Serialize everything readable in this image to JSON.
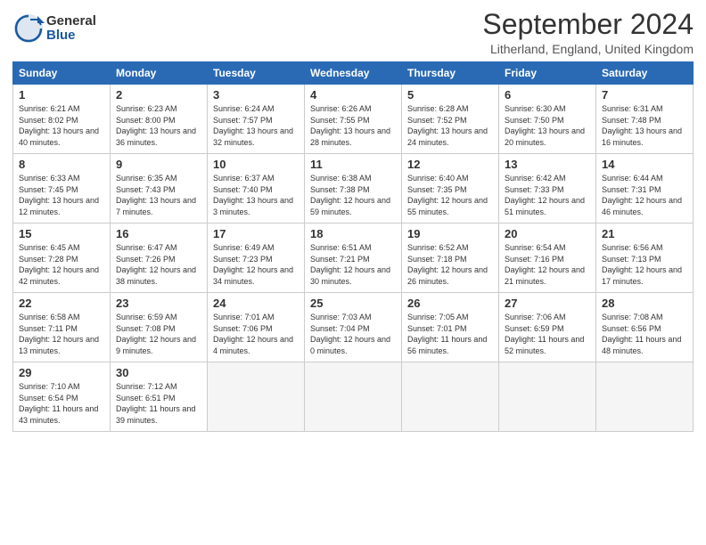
{
  "logo": {
    "general": "General",
    "blue": "Blue"
  },
  "title": "September 2024",
  "location": "Litherland, England, United Kingdom",
  "days_of_week": [
    "Sunday",
    "Monday",
    "Tuesday",
    "Wednesday",
    "Thursday",
    "Friday",
    "Saturday"
  ],
  "weeks": [
    [
      {
        "day": "1",
        "sunrise": "6:21 AM",
        "sunset": "8:02 PM",
        "daylight": "13 hours and 40 minutes."
      },
      {
        "day": "2",
        "sunrise": "6:23 AM",
        "sunset": "8:00 PM",
        "daylight": "13 hours and 36 minutes."
      },
      {
        "day": "3",
        "sunrise": "6:24 AM",
        "sunset": "7:57 PM",
        "daylight": "13 hours and 32 minutes."
      },
      {
        "day": "4",
        "sunrise": "6:26 AM",
        "sunset": "7:55 PM",
        "daylight": "13 hours and 28 minutes."
      },
      {
        "day": "5",
        "sunrise": "6:28 AM",
        "sunset": "7:52 PM",
        "daylight": "13 hours and 24 minutes."
      },
      {
        "day": "6",
        "sunrise": "6:30 AM",
        "sunset": "7:50 PM",
        "daylight": "13 hours and 20 minutes."
      },
      {
        "day": "7",
        "sunrise": "6:31 AM",
        "sunset": "7:48 PM",
        "daylight": "13 hours and 16 minutes."
      }
    ],
    [
      {
        "day": "8",
        "sunrise": "6:33 AM",
        "sunset": "7:45 PM",
        "daylight": "13 hours and 12 minutes."
      },
      {
        "day": "9",
        "sunrise": "6:35 AM",
        "sunset": "7:43 PM",
        "daylight": "13 hours and 7 minutes."
      },
      {
        "day": "10",
        "sunrise": "6:37 AM",
        "sunset": "7:40 PM",
        "daylight": "13 hours and 3 minutes."
      },
      {
        "day": "11",
        "sunrise": "6:38 AM",
        "sunset": "7:38 PM",
        "daylight": "12 hours and 59 minutes."
      },
      {
        "day": "12",
        "sunrise": "6:40 AM",
        "sunset": "7:35 PM",
        "daylight": "12 hours and 55 minutes."
      },
      {
        "day": "13",
        "sunrise": "6:42 AM",
        "sunset": "7:33 PM",
        "daylight": "12 hours and 51 minutes."
      },
      {
        "day": "14",
        "sunrise": "6:44 AM",
        "sunset": "7:31 PM",
        "daylight": "12 hours and 46 minutes."
      }
    ],
    [
      {
        "day": "15",
        "sunrise": "6:45 AM",
        "sunset": "7:28 PM",
        "daylight": "12 hours and 42 minutes."
      },
      {
        "day": "16",
        "sunrise": "6:47 AM",
        "sunset": "7:26 PM",
        "daylight": "12 hours and 38 minutes."
      },
      {
        "day": "17",
        "sunrise": "6:49 AM",
        "sunset": "7:23 PM",
        "daylight": "12 hours and 34 minutes."
      },
      {
        "day": "18",
        "sunrise": "6:51 AM",
        "sunset": "7:21 PM",
        "daylight": "12 hours and 30 minutes."
      },
      {
        "day": "19",
        "sunrise": "6:52 AM",
        "sunset": "7:18 PM",
        "daylight": "12 hours and 26 minutes."
      },
      {
        "day": "20",
        "sunrise": "6:54 AM",
        "sunset": "7:16 PM",
        "daylight": "12 hours and 21 minutes."
      },
      {
        "day": "21",
        "sunrise": "6:56 AM",
        "sunset": "7:13 PM",
        "daylight": "12 hours and 17 minutes."
      }
    ],
    [
      {
        "day": "22",
        "sunrise": "6:58 AM",
        "sunset": "7:11 PM",
        "daylight": "12 hours and 13 minutes."
      },
      {
        "day": "23",
        "sunrise": "6:59 AM",
        "sunset": "7:08 PM",
        "daylight": "12 hours and 9 minutes."
      },
      {
        "day": "24",
        "sunrise": "7:01 AM",
        "sunset": "7:06 PM",
        "daylight": "12 hours and 4 minutes."
      },
      {
        "day": "25",
        "sunrise": "7:03 AM",
        "sunset": "7:04 PM",
        "daylight": "12 hours and 0 minutes."
      },
      {
        "day": "26",
        "sunrise": "7:05 AM",
        "sunset": "7:01 PM",
        "daylight": "11 hours and 56 minutes."
      },
      {
        "day": "27",
        "sunrise": "7:06 AM",
        "sunset": "6:59 PM",
        "daylight": "11 hours and 52 minutes."
      },
      {
        "day": "28",
        "sunrise": "7:08 AM",
        "sunset": "6:56 PM",
        "daylight": "11 hours and 48 minutes."
      }
    ],
    [
      {
        "day": "29",
        "sunrise": "7:10 AM",
        "sunset": "6:54 PM",
        "daylight": "11 hours and 43 minutes."
      },
      {
        "day": "30",
        "sunrise": "7:12 AM",
        "sunset": "6:51 PM",
        "daylight": "11 hours and 39 minutes."
      },
      null,
      null,
      null,
      null,
      null
    ]
  ]
}
